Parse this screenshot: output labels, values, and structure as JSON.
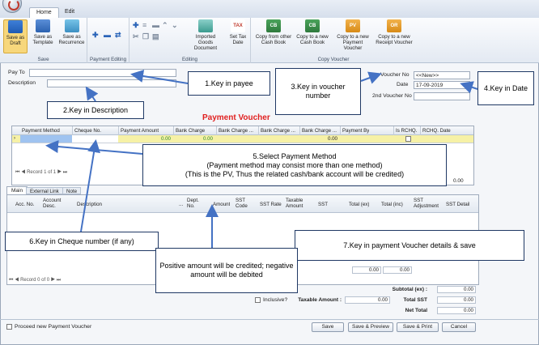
{
  "tabs": [
    "Home",
    "Edit"
  ],
  "ribbon": {
    "groups": [
      {
        "label": "Save"
      },
      {
        "label": "Payment Editing"
      },
      {
        "label": "Editing"
      },
      {
        "label": "Copy Voucher"
      }
    ],
    "buttons": {
      "save_draft": "Save as Draft",
      "save_template": "Save as Template",
      "save_recurrence": "Save as Recurrence",
      "imported_goods": "Imported Goods Document",
      "set_tax_date": "Set Tax Date",
      "tax_glyph": "TAX",
      "copy_from_cash": "Copy from other Cash Book",
      "copy_to_cash": "Copy to a new Cash Book",
      "copy_to_pv": "Copy to a new Payment Voucher",
      "copy_to_or": "Copy to a new Receipt Voucher",
      "cb_glyph": "CB",
      "pv_glyph": "PV",
      "or_glyph": "OR"
    }
  },
  "form": {
    "pay_to_label": "Pay To",
    "description_label": "Description",
    "voucher_no_label": "Voucher No",
    "voucher_no_value": "<<New>>",
    "date_label": "Date",
    "date_value": "17-09-2019",
    "second_voucher_label": "2nd Voucher No",
    "title": "Payment Voucher"
  },
  "payment_grid": {
    "columns": [
      "Payment Method",
      "Cheque No.",
      "Payment Amount",
      "Bank Charge",
      "Bank Charge ...",
      "Bank Charge ...",
      "Bank Charge ...",
      "Payment By",
      "Is RCHQ.",
      "RCHQ. Date"
    ],
    "row": {
      "amount": "0.00",
      "bank_charge": "0.00",
      "bank_charge_2": "0.00"
    },
    "nav": "Record 1 of 1",
    "total": "0.00"
  },
  "detail_tabs": [
    "Main",
    "External Link",
    "Note"
  ],
  "detail_grid": {
    "columns": [
      "Acc. No.",
      "Account Desc.",
      "Description",
      "...",
      "Dept. No.",
      "Amount",
      "SST Code",
      "SST Rate",
      "Taxable Amount",
      "SST",
      "Total (ex)",
      "Total (inc)",
      "SST Adjustment",
      "SST Detail"
    ],
    "footer_total_ex": "0.00",
    "footer_total_inc": "0.00",
    "nav": "Record 0 of 0"
  },
  "totals": {
    "subtotal_label": "Subtotal (ex) :",
    "subtotal_value": "0.00",
    "inclusive_label": "Inclusive?",
    "taxable_label": "Taxable Amount :",
    "taxable_value": "0.00",
    "total_sst_label": "Total SST",
    "total_sst_value": "0.00",
    "net_total_label": "Net Total",
    "net_total_value": "0.00"
  },
  "footer": {
    "proceed_label": "Proceed new Payment Voucher",
    "save": "Save",
    "save_preview": "Save & Preview",
    "save_print": "Save & Print",
    "cancel": "Cancel"
  },
  "callouts": {
    "c1": "1.Key in payee",
    "c2": "2.Key in Description",
    "c3": "3.Key in voucher number",
    "c4": "4.Key in Date",
    "c5_line1": "5.Select Payment Method",
    "c5_line2": "(Payment method may consist more than one method)",
    "c5_line3": "(This is the PV, Thus the related cash/bank account will be credited)",
    "c6": "6.Key in Cheque number (if any)",
    "c7": "7.Key in payment Voucher details & save",
    "c8": "Positive amount will be credited; negative amount will be debited"
  },
  "colors": {
    "accent": "#2a64b8",
    "title_red": "#e02020",
    "row_highlight": "#f6f1a6",
    "arrow": "#4472c4"
  }
}
